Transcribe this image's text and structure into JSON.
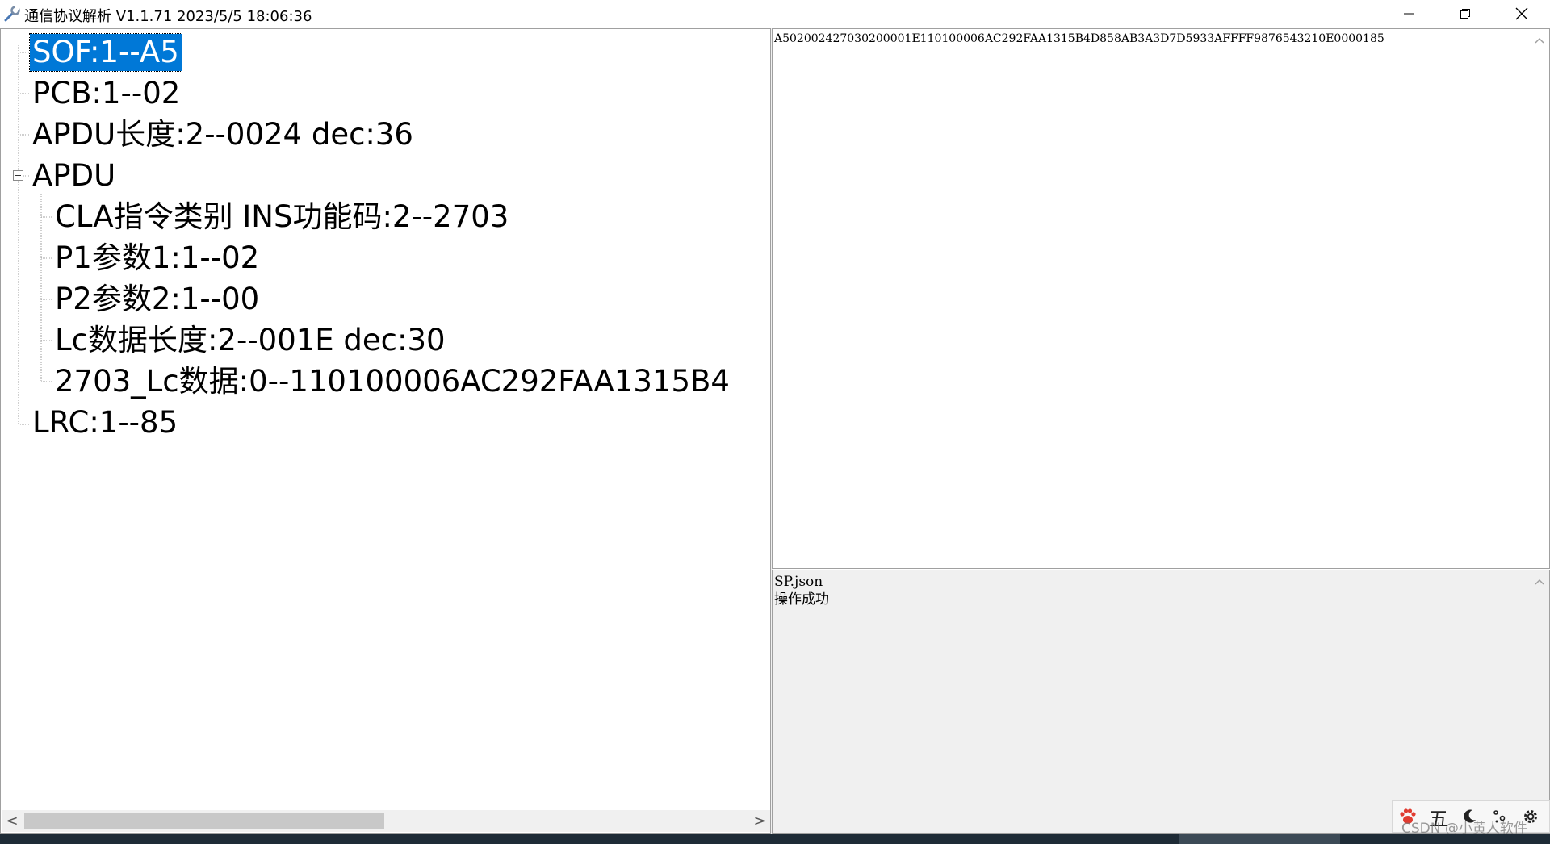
{
  "window": {
    "title": "通信协议解析 V1.1.71 2023/5/5 18:06:36",
    "icon": "wrench-icon",
    "controls": {
      "minimize": "minimize-icon",
      "maximize": "restore-icon",
      "close": "close-icon"
    }
  },
  "tree": {
    "nodes": [
      {
        "label": "SOF:1--A5",
        "selected": true
      },
      {
        "label": "PCB:1--02"
      },
      {
        "label": "APDU长度:2--0024  dec:36"
      },
      {
        "label": "APDU",
        "expanded": true
      },
      {
        "label": "CLA指令类别 INS功能码:2--2703"
      },
      {
        "label": "P1参数1:1--02"
      },
      {
        "label": "P2参数2:1--00"
      },
      {
        "label": "Lc数据长度:2--001E  dec:30"
      },
      {
        "label": "2703_Lc数据:0--110100006AC292FAA1315B4"
      },
      {
        "label": "LRC:1--85"
      }
    ],
    "scrollbar": {
      "left_arrow": "<",
      "right_arrow": ">",
      "position": 0.0
    }
  },
  "hex_box": {
    "text": "A502002427030200001E110100006AC292FAA1315B4D858AB3A3D7D5933AFFFF9876543210E0000185"
  },
  "log_box": {
    "lines": [
      "SP.json",
      "操作成功"
    ]
  },
  "ime": {
    "items": [
      "paw-icon",
      "五",
      "moon-icon",
      "dots-icon",
      "gear-icon"
    ],
    "watermark": "CSDN @小黄人软件"
  },
  "colors": {
    "selection": "#0078d7",
    "panel_border": "#a0a0a0",
    "log_bg": "#f0f0f0"
  }
}
